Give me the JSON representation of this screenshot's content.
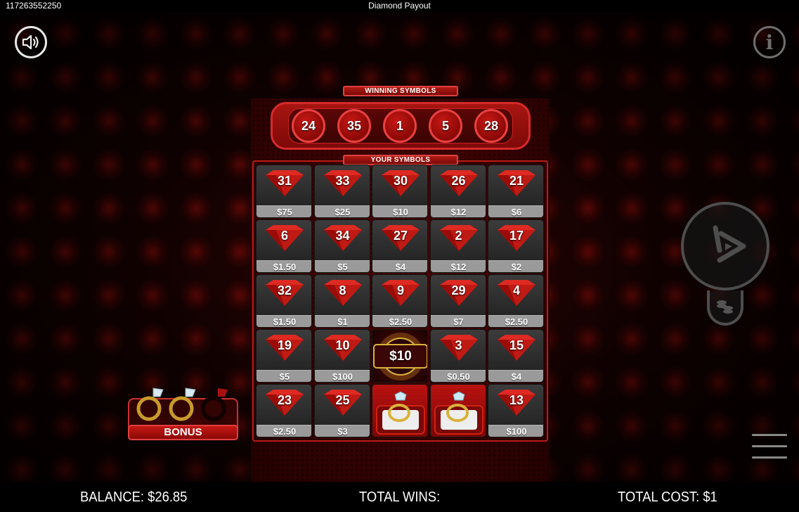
{
  "topbar": {
    "game_id": "117263552250",
    "title": "Diamond Payout"
  },
  "banners": {
    "winning": "WINNING SYMBOLS",
    "yours": "YOUR SYMBOLS"
  },
  "winning_numbers": [
    "24",
    "35",
    "1",
    "5",
    "28"
  ],
  "cells": [
    {
      "num": "31",
      "prize": "$75"
    },
    {
      "num": "33",
      "prize": "$25"
    },
    {
      "num": "30",
      "prize": "$10"
    },
    {
      "num": "26",
      "prize": "$12"
    },
    {
      "num": "21",
      "prize": "$6"
    },
    {
      "num": "6",
      "prize": "$1.50"
    },
    {
      "num": "34",
      "prize": "$5"
    },
    {
      "num": "27",
      "prize": "$4"
    },
    {
      "num": "2",
      "prize": "$12"
    },
    {
      "num": "17",
      "prize": "$2"
    },
    {
      "num": "32",
      "prize": "$1.50"
    },
    {
      "num": "8",
      "prize": "$1"
    },
    {
      "num": "9",
      "prize": "$2.50"
    },
    {
      "num": "29",
      "prize": "$7"
    },
    {
      "num": "4",
      "prize": "$2.50"
    },
    {
      "num": "19",
      "prize": "$5"
    },
    {
      "num": "10",
      "prize": "$100"
    },
    {
      "special": "bonus-prize",
      "value": "$10"
    },
    {
      "num": "3",
      "prize": "$0.50"
    },
    {
      "num": "15",
      "prize": "$4"
    },
    {
      "num": "23",
      "prize": "$2.50"
    },
    {
      "num": "25",
      "prize": "$3"
    },
    {
      "special": "ring"
    },
    {
      "special": "ring"
    },
    {
      "num": "13",
      "prize": "$100"
    }
  ],
  "bonus": {
    "label": "BONUS",
    "collected": 2,
    "total": 3
  },
  "bottombar": {
    "balance": "BALANCE: $26.85",
    "total_wins": "TOTAL WINS:",
    "total_cost": "TOTAL COST: $1"
  },
  "colors": {
    "accent_red": "#c41814",
    "gold": "#d9b23a",
    "prize_gray": "#9a9a9a"
  },
  "icons": {
    "sound": "speaker-icon",
    "info": "info-icon",
    "play": "play-icon",
    "coins": "coin-stack-icon",
    "menu": "hamburger-menu-icon"
  }
}
